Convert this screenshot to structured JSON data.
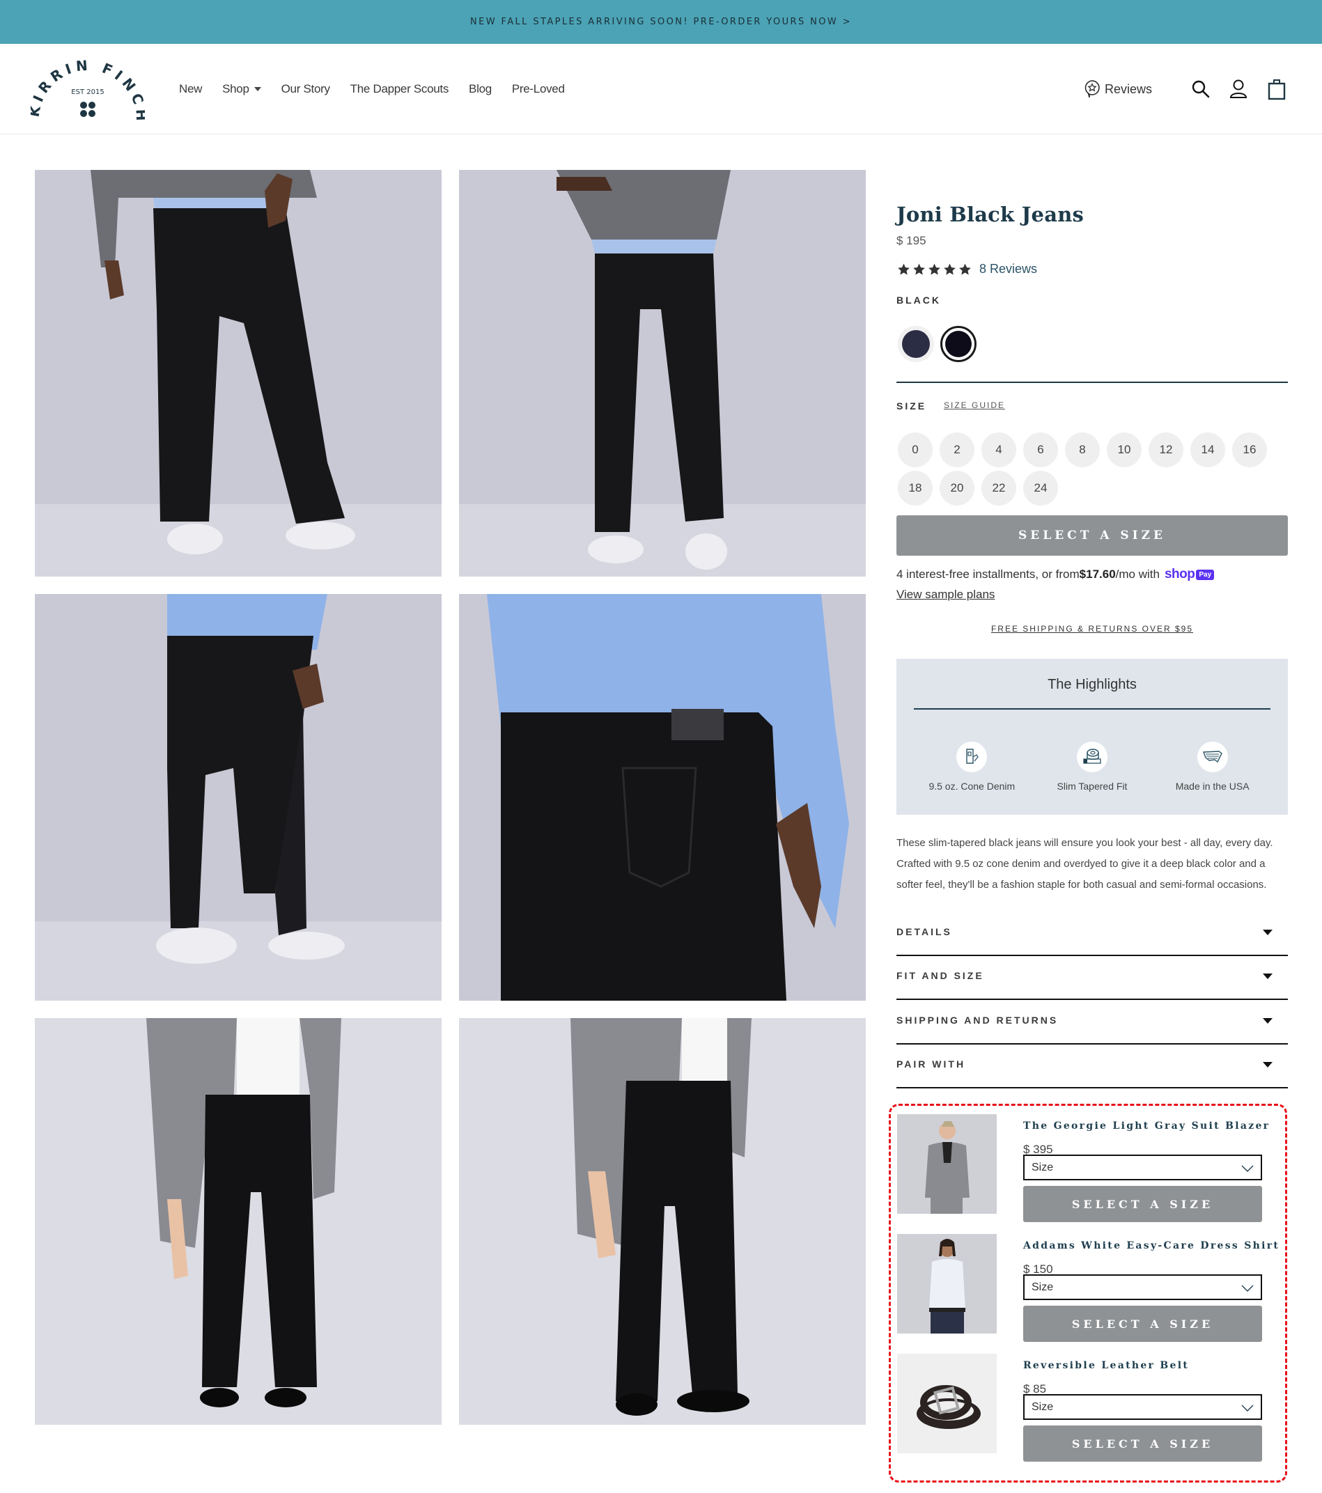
{
  "announcement": {
    "text": "NEW FALL STAPLES ARRIVING SOON! PRE-ORDER YOURS NOW >"
  },
  "header": {
    "logo": {
      "brand": "KIRRIN FINCH",
      "est": "EST 2015"
    },
    "nav": [
      {
        "label": "New"
      },
      {
        "label": "Shop",
        "has_dropdown": true
      },
      {
        "label": "Our Story"
      },
      {
        "label": "The Dapper Scouts"
      },
      {
        "label": "Blog"
      },
      {
        "label": "Pre-Loved"
      }
    ],
    "reviews_label": "Reviews",
    "icons": [
      "search-icon",
      "account-icon",
      "cart-bag-icon"
    ]
  },
  "gallery": {
    "images": [
      {
        "alt": "Front view of black jeans with gray sweater and white sneakers"
      },
      {
        "alt": "Front angled view of black jeans with gray sweater and white sneakers"
      },
      {
        "alt": "Side view of black jeans with blue shirt and white sneakers"
      },
      {
        "alt": "Back pocket close-up of black jeans with leather patch"
      },
      {
        "alt": "Front view of black jeans with gray blazer and black dress shoes"
      },
      {
        "alt": "Angled view of black jeans with gray blazer and black dress shoes"
      }
    ]
  },
  "product": {
    "title": "Joni Black Jeans",
    "price": "$ 195",
    "rating": {
      "stars": 5,
      "reviews_label": "8 Reviews"
    },
    "color": {
      "selected_label": "BLACK",
      "swatches": [
        {
          "name": "navy",
          "color": "#2b2d45",
          "selected": false
        },
        {
          "name": "black",
          "color": "#0d0c18",
          "selected": true
        }
      ]
    },
    "size": {
      "label": "SIZE",
      "guide_label": "SIZE GUIDE",
      "options": [
        "0",
        "2",
        "4",
        "6",
        "8",
        "10",
        "12",
        "14",
        "16",
        "18",
        "20",
        "22",
        "24"
      ]
    },
    "add_button_label": "SELECT A SIZE",
    "installments": {
      "prefix": "4 interest-free installments, or from ",
      "amount": "$17.60",
      "suffix": "/mo with",
      "shop_word": "shop",
      "pay_badge": "Pay",
      "view_plans": "View sample plans"
    },
    "free_shipping": "FREE SHIPPING & RETURNS OVER $95",
    "highlights": {
      "title": "The Highlights",
      "items": [
        {
          "icon": "denim-icon",
          "label": "9.5 oz. Cone Denim"
        },
        {
          "icon": "tape-measure-icon",
          "label": "Slim Tapered Fit"
        },
        {
          "icon": "usa-map-icon",
          "label": "Made in the USA"
        }
      ]
    },
    "description": "These slim-tapered black jeans will ensure you look your best - all day, every day. Crafted with 9.5 oz cone denim and overdyed to give it a deep black color and a softer feel, they'll be a fashion staple for both casual and semi-formal occasions.",
    "accordions": [
      {
        "label": "DETAILS"
      },
      {
        "label": "FIT AND SIZE"
      },
      {
        "label": "SHIPPING AND RETURNS"
      },
      {
        "label": "PAIR WITH"
      }
    ]
  },
  "pair_with": {
    "items": [
      {
        "name": "The Georgie Light Gray Suit Blazer",
        "price": "$ 395",
        "select_placeholder": "Size",
        "button_label": "SELECT A SIZE"
      },
      {
        "name": "Addams White Easy-Care Dress Shirt",
        "price": "$ 150",
        "select_placeholder": "Size",
        "button_label": "SELECT A SIZE"
      },
      {
        "name": "Reversible Leather Belt",
        "price": "$ 85",
        "select_placeholder": "Size",
        "button_label": "SELECT A SIZE"
      }
    ]
  },
  "colors": {
    "announcement_bg": "#4ba3b5",
    "brand_dark": "#1e3e4e",
    "button_gray": "#8f9295",
    "highlights_bg": "#dfe5eb",
    "shop_pay": "#5a31f4",
    "highlight_box": "#e8101a"
  }
}
